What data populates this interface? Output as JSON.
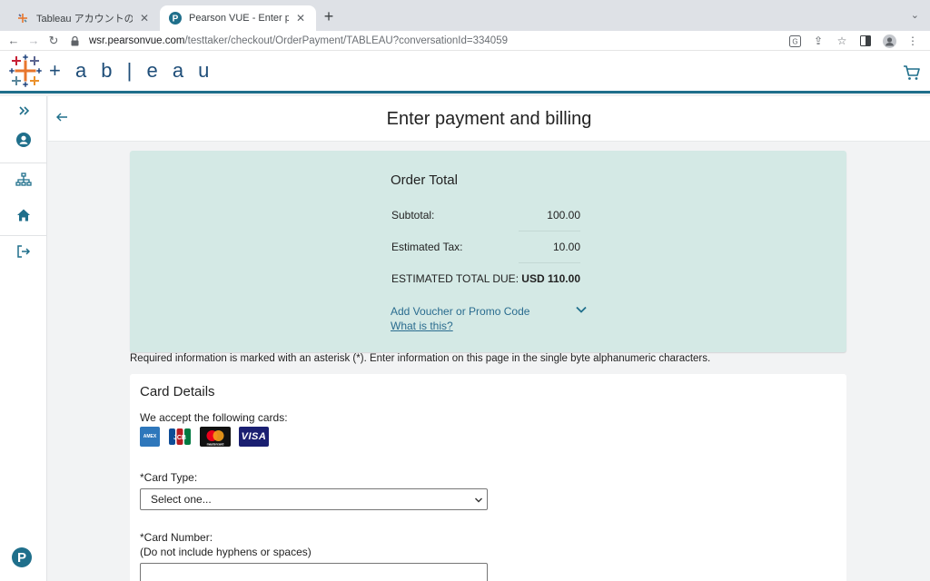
{
  "browser": {
    "tabs": [
      {
        "title": "Tableau アカウントの登録",
        "active": false,
        "favicon": "tableau-favicon"
      },
      {
        "title": "Pearson VUE - Enter payment",
        "active": true,
        "favicon": "pearson-favicon"
      }
    ],
    "url_domain": "wsr.pearsonvue.com",
    "url_path": "/testtaker/checkout/OrderPayment/TABLEAU?conversationId=334059"
  },
  "header": {
    "logo_text": "+ a b | e a u",
    "cart_icon": "cart-icon"
  },
  "page": {
    "title": "Enter payment and billing"
  },
  "order": {
    "title": "Order Total",
    "rows": [
      {
        "label": "Subtotal:",
        "value": "100.00"
      },
      {
        "label": "Estimated Tax:",
        "value": "10.00"
      },
      {
        "label": "ESTIMATED TOTAL DUE:",
        "value": "USD 110.00"
      }
    ],
    "voucher_link": "Add Voucher or Promo Code",
    "what_is_this": "What is this?"
  },
  "required_note": "Required information is marked with an asterisk (*). Enter information on this page in the single byte alphanumeric characters.",
  "card": {
    "title": "Card Details",
    "accept_text": "We accept the following cards:",
    "logos": [
      "AMEX",
      "JCB",
      "mastercard",
      "VISA"
    ],
    "card_type_label": "*Card Type:",
    "card_type_value": "Select one...",
    "card_number_label": "*Card Number:",
    "card_number_hint": "(Do not include hyphens or spaces)"
  },
  "colors": {
    "accent": "#1f6f8b",
    "order_bg": "#d4e9e5",
    "link": "#2a6c8f"
  }
}
